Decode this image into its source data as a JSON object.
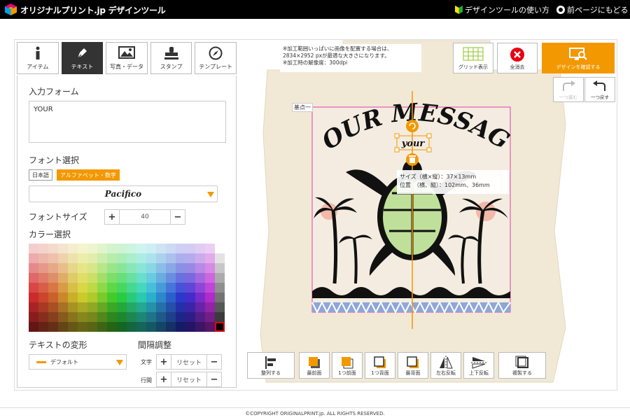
{
  "header": {
    "logo_text": "オリジナルプリント.jp デザインツール",
    "help_link": "デザインツールの使い方",
    "back_link": "前ページにもどる"
  },
  "tabs": [
    {
      "label": "アイテム",
      "icon": "info-icon"
    },
    {
      "label": "テキスト",
      "icon": "pen-icon",
      "active": true
    },
    {
      "label": "写真・データ",
      "icon": "image-icon"
    },
    {
      "label": "スタンプ",
      "icon": "stamp-icon"
    },
    {
      "label": "テンプレート",
      "icon": "compass-icon"
    }
  ],
  "text_panel": {
    "input_label": "入力フォーム",
    "input_value": "YOUR",
    "font_label": "フォント選択",
    "font_japanese": "日本語",
    "font_alpha": "アルファベット・数字",
    "font_value": "Pacifico",
    "size_label": "フォントサイズ",
    "size_value": "40",
    "color_label": "カラー選択",
    "transform_label": "テキストの変形",
    "transform_value": "デフォルト",
    "spacing_label": "間隔調整",
    "char_label": "文字",
    "line_label": "行間",
    "reset": "リセット",
    "plus": "+",
    "minus": "−"
  },
  "notice": {
    "line1": "※加工範囲いっぱいに画像を配置する場合は、",
    "line2": "2834×2952 pxが最適な大きさになります。",
    "line3": "※加工時の解像度：300dpi"
  },
  "toolbar": {
    "grid": "グリッド表示",
    "clear": "全消去",
    "confirm": "デザインを確認する",
    "redo": "一つ進む",
    "undo": "一つ戻す"
  },
  "canvas": {
    "baseline": "基点一",
    "message_text": "YOUR MESSAGE",
    "selected_text": "your",
    "size_line": "サイズ（横×縦）：37×13mm",
    "position_line": "位置　（横、縦）：102mm、36mm"
  },
  "bottom_tools": {
    "align": "整列する",
    "front": "最前面",
    "forward": "1つ前面",
    "backward": "1つ背面",
    "back": "最背面",
    "flip_h": "左右反転",
    "flip_v": "上下反転",
    "duplicate": "複製する"
  },
  "footer": "©COPYRIGHT ORIGINALPRINT.jp. ALL RIGHTS RESERVED.",
  "colors": {
    "accent": "#f39800",
    "header_bg": "#000000",
    "bag": "#f1e9d6",
    "selection": "#e040b0"
  }
}
